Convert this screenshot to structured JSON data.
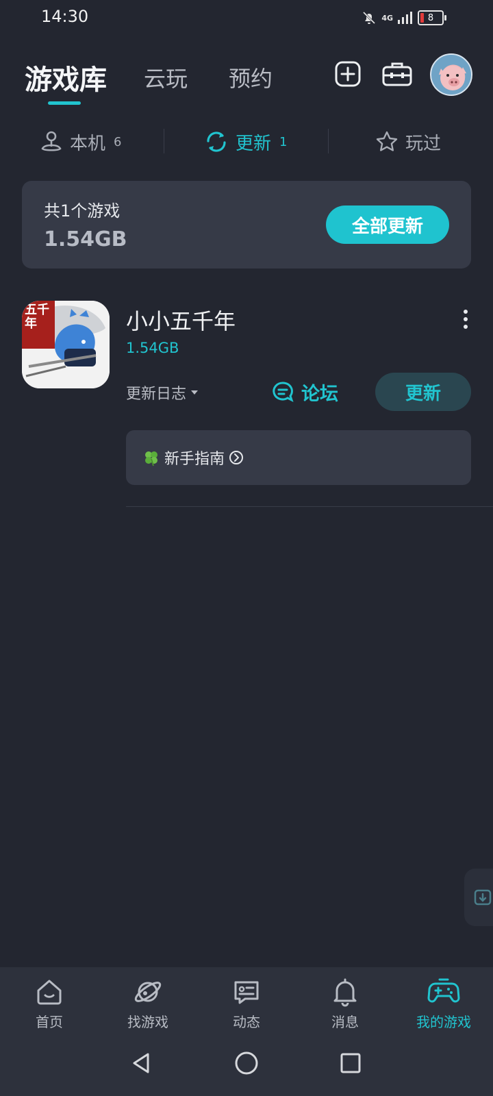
{
  "status_bar": {
    "time": "14:30",
    "network": "4G",
    "battery": "8"
  },
  "top_tabs": [
    {
      "label": "游戏库",
      "active": true
    },
    {
      "label": "云玩",
      "active": false
    },
    {
      "label": "预约",
      "active": false
    }
  ],
  "top_icons": {
    "add": "plus-square-icon",
    "toolbox": "toolbox-icon",
    "avatar": "user-avatar"
  },
  "sub_tabs": [
    {
      "label": "本机",
      "count": "6",
      "icon": "joystick-icon",
      "active": false
    },
    {
      "label": "更新",
      "count": "1",
      "icon": "refresh-icon",
      "active": true
    },
    {
      "label": "玩过",
      "count": "",
      "icon": "star-icon",
      "active": false
    }
  ],
  "summary": {
    "count_text": "共1个游戏",
    "size": "1.54GB",
    "update_all_label": "全部更新"
  },
  "games": [
    {
      "name": "小小五千年",
      "size": "1.54GB",
      "changelog_label": "更新日志",
      "forum_label": "论坛",
      "update_label": "更新",
      "guide_label": "新手指南",
      "icon_art_text": "五千年"
    }
  ],
  "bottom_nav": [
    {
      "label": "首页",
      "icon": "home-icon",
      "active": false
    },
    {
      "label": "找游戏",
      "icon": "planet-icon",
      "active": false
    },
    {
      "label": "动态",
      "icon": "message-card-icon",
      "active": false
    },
    {
      "label": "消息",
      "icon": "bell-icon",
      "active": false
    },
    {
      "label": "我的游戏",
      "icon": "gamepad-icon",
      "active": true
    }
  ],
  "colors": {
    "accent": "#21c4cf",
    "background": "#232630",
    "card": "#363a47",
    "nav": "#2d313c"
  }
}
